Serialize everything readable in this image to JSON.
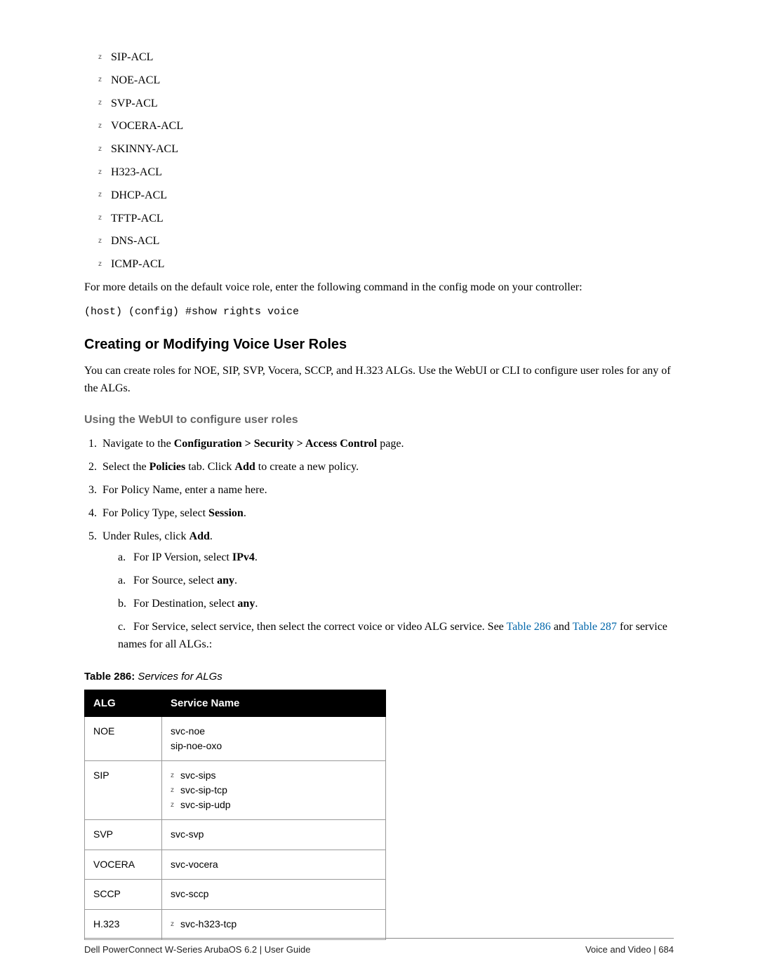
{
  "acl_list": [
    "SIP-ACL",
    "NOE-ACL",
    "SVP-ACL",
    "VOCERA-ACL",
    "SKINNY-ACL",
    "H323-ACL",
    "DHCP-ACL",
    "TFTP-ACL",
    "DNS-ACL",
    "ICMP-ACL"
  ],
  "para_details": "For more details on the default voice role, enter the following command in the config mode on your controller:",
  "code_line": "(host) (config) #show rights voice",
  "heading_creating": "Creating or Modifying Voice User Roles",
  "para_create": "You can create roles for NOE, SIP, SVP, Vocera, SCCP, and H.323 ALGs. Use the WebUI or CLI to configure user roles for any of the ALGs.",
  "heading_webui": "Using the WebUI to configure user roles",
  "steps": {
    "s1_pre": "Navigate to the ",
    "s1_bold": "Configuration > Security > Access Control",
    "s1_post": " page.",
    "s2_pre": "Select the ",
    "s2_b1": "Policies",
    "s2_mid": " tab. Click ",
    "s2_b2": "Add",
    "s2_post": " to create a new policy.",
    "s3": "For Policy Name, enter a name here.",
    "s4_pre": "For Policy Type, select ",
    "s4_bold": "Session",
    "s4_post": ".",
    "s5_pre": "Under Rules, click ",
    "s5_bold": "Add",
    "s5_post": ".",
    "sa1_pre": "For IP Version, select ",
    "sa1_bold": "IPv4",
    "sa1_post": ".",
    "sa2_pre": "For Source, select ",
    "sa2_bold": "any",
    "sa2_post": ".",
    "sb_pre": "For Destination, select ",
    "sb_bold": "any",
    "sb_post": ".",
    "sc_pre": "For Service, select service, then select the correct voice or video ALG service. See ",
    "sc_link1": "Table 286",
    "sc_mid": " and ",
    "sc_link2": "Table 287",
    "sc_post": " for service names for all ALGs.:"
  },
  "table_caption_num": "Table 286:",
  "table_caption_title": " Services for ALGs",
  "table_headers": {
    "alg": "ALG",
    "svc": "Service Name"
  },
  "table_rows": [
    {
      "alg": "NOE",
      "svc_plain": [
        "svc-noe",
        "sip-noe-oxo"
      ]
    },
    {
      "alg": "SIP",
      "svc_bullet": [
        "svc-sips",
        "svc-sip-tcp",
        "svc-sip-udp"
      ]
    },
    {
      "alg": "SVP",
      "svc_plain": [
        "svc-svp"
      ]
    },
    {
      "alg": "VOCERA",
      "svc_plain": [
        "svc-vocera"
      ]
    },
    {
      "alg": "SCCP",
      "svc_plain": [
        "svc-sccp"
      ]
    },
    {
      "alg": "H.323",
      "svc_bullet": [
        "svc-h323-tcp"
      ]
    }
  ],
  "footer_left": "Dell PowerConnect W-Series ArubaOS 6.2 | User Guide",
  "footer_right": "Voice and Video | 684"
}
